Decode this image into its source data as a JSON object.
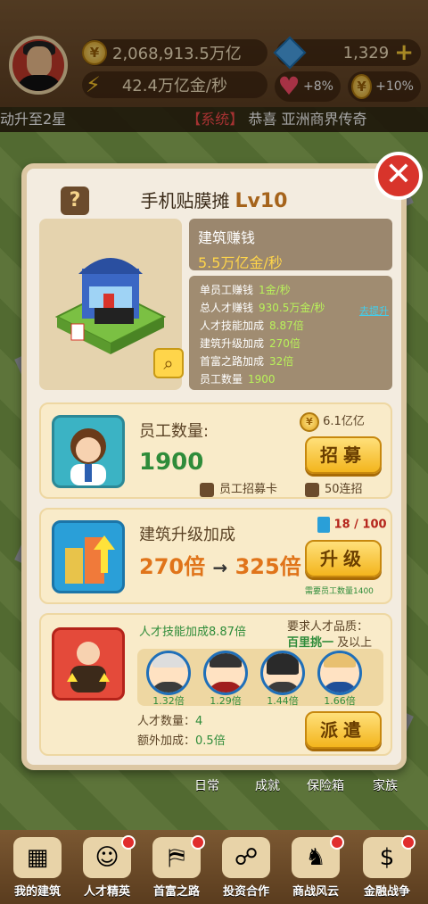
{
  "hud": {
    "gold": "2,068,913.5万亿",
    "gold_rate": "42.4万亿金/秒",
    "gems": "1,329",
    "heart_boost": "+8%",
    "coin_boost": "+10%"
  },
  "ticker": {
    "left": "动升至2星",
    "system": "【系统】",
    "message": "恭喜 亚洲商界传奇"
  },
  "modal": {
    "title": "手机贴膜摊",
    "level": "Lv10",
    "earn_label": "建筑赚钱",
    "earn_value": "5.5万亿金/秒",
    "stats": [
      {
        "label": "单员工赚钱",
        "value": "1金/秒"
      },
      {
        "label": "总人才赚钱",
        "value": "930.5万金/秒"
      },
      {
        "label": "人才技能加成",
        "value": "8.87倍"
      },
      {
        "label": "建筑升级加成",
        "value": "270倍"
      },
      {
        "label": "首富之路加成",
        "value": "32倍"
      },
      {
        "label": "员工数量",
        "value": "1900"
      }
    ],
    "stats_link": "去提升",
    "staff": {
      "label": "员工数量:",
      "count": "1900",
      "cost": "6.1亿亿",
      "button": "招募",
      "card_option": "员工招募卡",
      "bulk_option": "50连招"
    },
    "upgrade": {
      "label": "建筑升级加成",
      "from": "270倍",
      "arrow": "→",
      "to": "325倍",
      "progress": "18 / 100",
      "button": "升级",
      "requirement": "需要员工数量1400"
    },
    "talent": {
      "skill_bonus": "人才技能加成8.87倍",
      "quality_label": "要求人才品质：",
      "quality_value": "百里挑一",
      "quality_suffix": "及以上",
      "multipliers": [
        "1.32倍",
        "1.29倍",
        "1.44倍",
        "1.66倍"
      ],
      "count_label": "人才数量：",
      "count": "4",
      "extra_label": "额外加成：",
      "extra": "0.5倍",
      "button": "派遣"
    }
  },
  "lower_menu": [
    "日常",
    "成就",
    "保险箱",
    "家族"
  ],
  "nav": [
    {
      "label": "我的建筑"
    },
    {
      "label": "人才精英"
    },
    {
      "label": "首富之路"
    },
    {
      "label": "投资合作"
    },
    {
      "label": "商战风云"
    },
    {
      "label": "金融战争"
    }
  ]
}
